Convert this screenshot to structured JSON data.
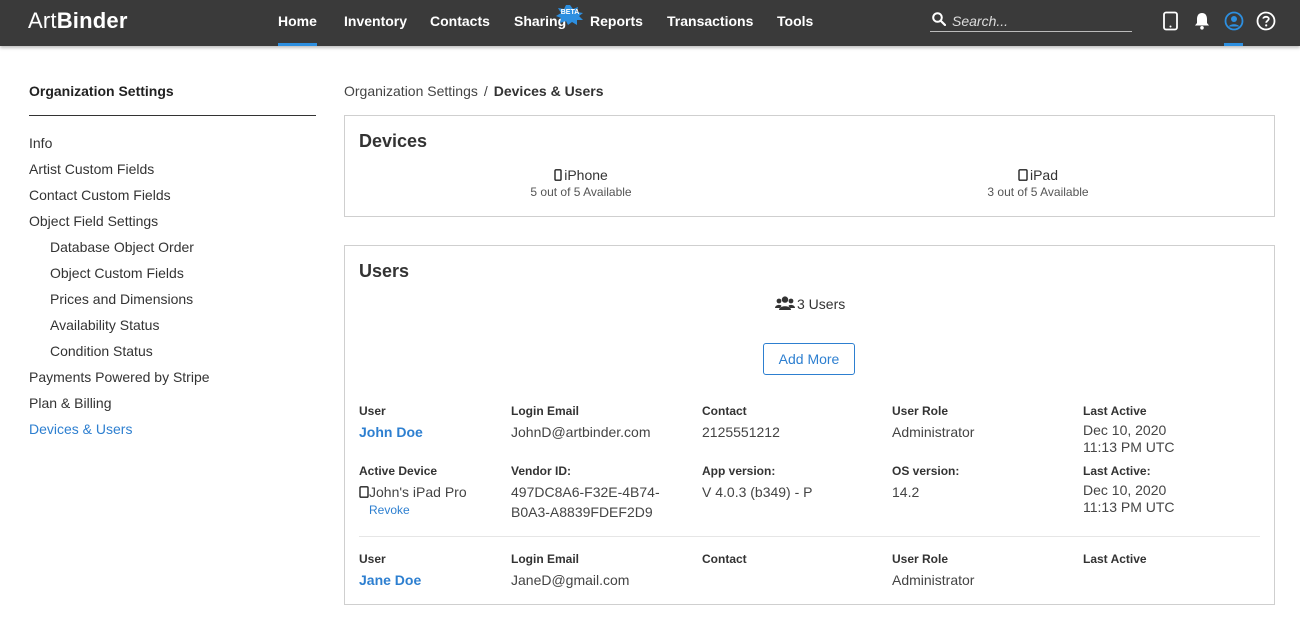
{
  "brand": {
    "thin": "Art",
    "bold": "Binder"
  },
  "nav": {
    "items": [
      "Home",
      "Inventory",
      "Contacts",
      "Sharing",
      "Reports",
      "Transactions",
      "Tools"
    ],
    "active": "Home",
    "beta_badge": "BETA"
  },
  "search": {
    "placeholder": "Search..."
  },
  "top_icons": [
    "tablet-icon",
    "bell-icon",
    "user-profile-icon",
    "help-icon"
  ],
  "colors": {
    "topbar": "#3a3a3a",
    "accent": "#2d7fd0",
    "active_underline": "#2d8fe0"
  },
  "sidebar": {
    "title": "Organization Settings",
    "items": [
      {
        "label": "Info"
      },
      {
        "label": "Artist Custom Fields"
      },
      {
        "label": "Contact Custom Fields"
      },
      {
        "label": "Object Field Settings"
      },
      {
        "label": "Database Object Order"
      },
      {
        "label": "Object Custom Fields"
      },
      {
        "label": "Prices and Dimensions"
      },
      {
        "label": "Availability Status"
      },
      {
        "label": "Condition Status"
      },
      {
        "label": "Payments Powered by Stripe"
      },
      {
        "label": "Plan & Billing"
      },
      {
        "label": "Devices & Users"
      }
    ],
    "active": "Devices & Users"
  },
  "breadcrumb": {
    "parent": "Organization Settings",
    "separator": "/",
    "current": "Devices & Users"
  },
  "devices": {
    "title": "Devices",
    "items": [
      {
        "name": "iPhone",
        "availability": "5 out of 5 Available"
      },
      {
        "name": "iPad",
        "availability": "3 out of 5 Available"
      }
    ]
  },
  "users": {
    "title": "Users",
    "count_label": "3 Users",
    "add_button": "Add More",
    "labels": {
      "user": "User",
      "login_email": "Login Email",
      "contact": "Contact",
      "user_role": "User Role",
      "last_active": "Last Active",
      "active_device": "Active Device",
      "vendor_id": "Vendor ID:",
      "app_version": "App version:",
      "os_version": "OS version:",
      "last_active_colon": "Last Active:"
    },
    "rows": [
      {
        "name": "John Doe",
        "email": "JohnD@artbinder.com",
        "contact": "2125551212",
        "role": "Administrator",
        "last_active_line1": "Dec 10, 2020",
        "last_active_line2": "11:13 PM UTC",
        "device": {
          "name": "John's iPad Pro",
          "revoke": "Revoke",
          "vendor_id_line1": "497DC8A6-F32E-4B74-",
          "vendor_id_line2": "B0A3-A8839FDEF2D9",
          "app_version": "V 4.0.3 (b349) - P",
          "os_version": "14.2",
          "last_active_line1": "Dec 10, 2020",
          "last_active_line2": "11:13 PM UTC"
        }
      },
      {
        "name": "Jane Doe",
        "email": "JaneD@gmail.com",
        "contact": "",
        "role": "Administrator",
        "last_active_line1": "",
        "last_active_line2": ""
      }
    ]
  }
}
